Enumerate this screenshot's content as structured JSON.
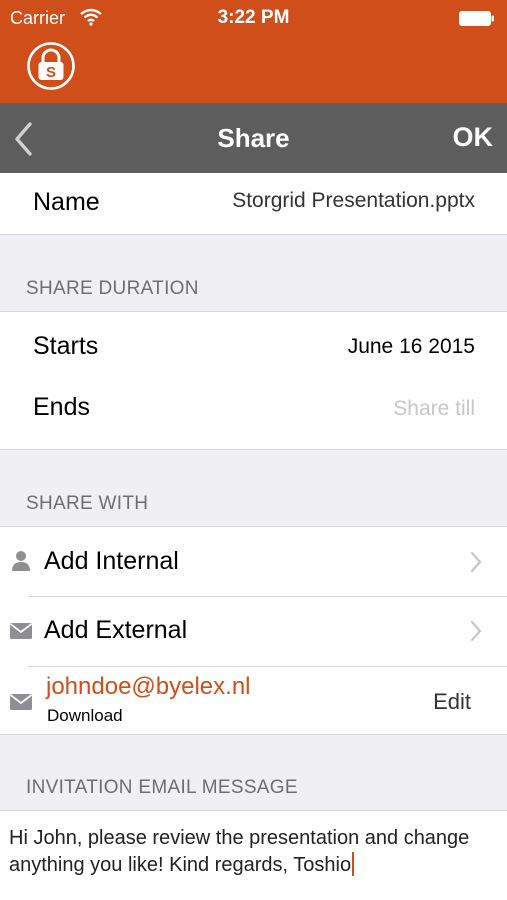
{
  "status_bar": {
    "carrier": "Carrier",
    "time": "3:22 PM"
  },
  "colors": {
    "brand": "#cf4e1a",
    "nav": "#5d5d5d",
    "background": "#efeff4"
  },
  "nav": {
    "title": "Share",
    "ok_label": "OK",
    "back_icon": "chevron-left-icon"
  },
  "name_row": {
    "label": "Name",
    "value": "Storgrid Presentation.pptx"
  },
  "share_duration": {
    "header": "SHARE DURATION",
    "starts_label": "Starts",
    "starts_value": "June 16 2015",
    "ends_label": "Ends",
    "ends_placeholder": "Share till"
  },
  "share_with": {
    "header": "SHARE WITH",
    "add_internal": "Add Internal",
    "add_external": "Add External",
    "recipient": {
      "email": "johndoe@byelex.nl",
      "permission": "Download",
      "edit_label": "Edit"
    }
  },
  "invitation": {
    "header": "INVITATION EMAIL MESSAGE",
    "message": "Hi John, please review the presentation and change anything you like! Kind regards, Toshio"
  }
}
